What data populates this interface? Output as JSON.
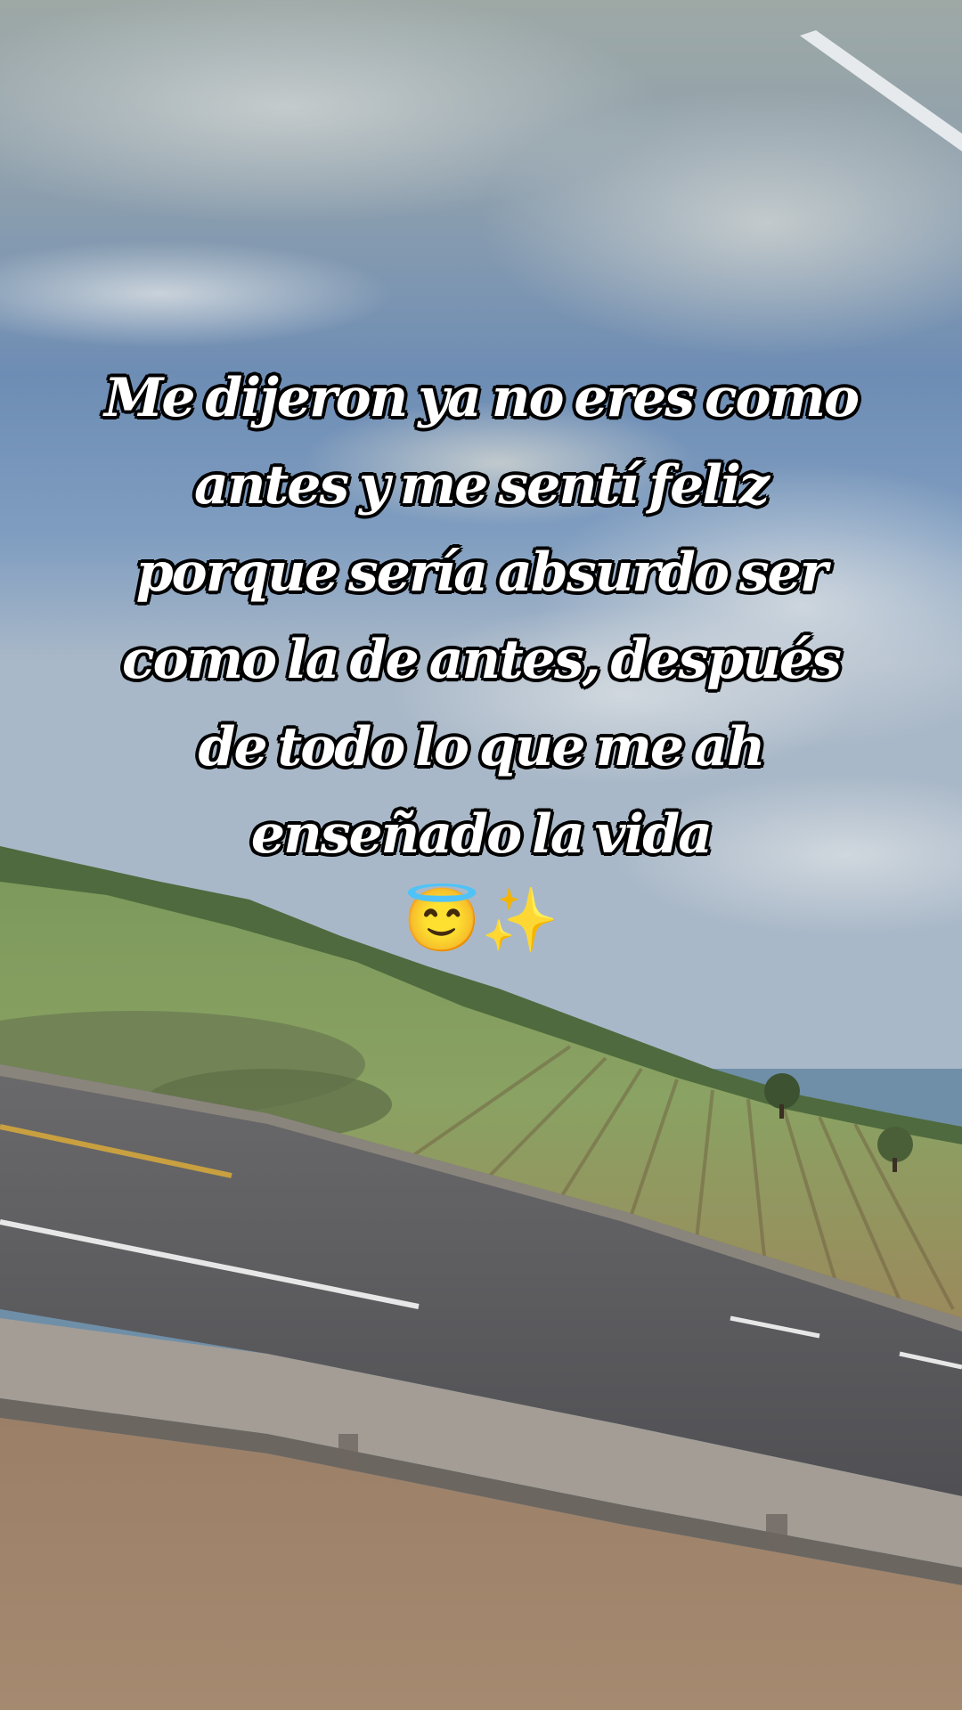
{
  "caption": {
    "lines": [
      "Me dijeron ya no eres como",
      "antes y me sentí feliz",
      "porque sería absurdo ser",
      "como la de antes, después",
      "de todo lo que me ah",
      "enseñado la vida"
    ],
    "emoji": "😇✨"
  },
  "scene": {
    "description_icons": [
      "sky-background",
      "crop-field",
      "highway",
      "guardrail"
    ],
    "colors": {
      "sky_top": "#9aa6a5",
      "sky_mid": "#6f8fb3",
      "sky_low": "#8fa8c2",
      "field": "#7f9a5a",
      "soil": "#a88a62",
      "road": "#5f5f62",
      "rail": "#9a948c",
      "text": "#ffffff",
      "outline": "#000000"
    }
  }
}
